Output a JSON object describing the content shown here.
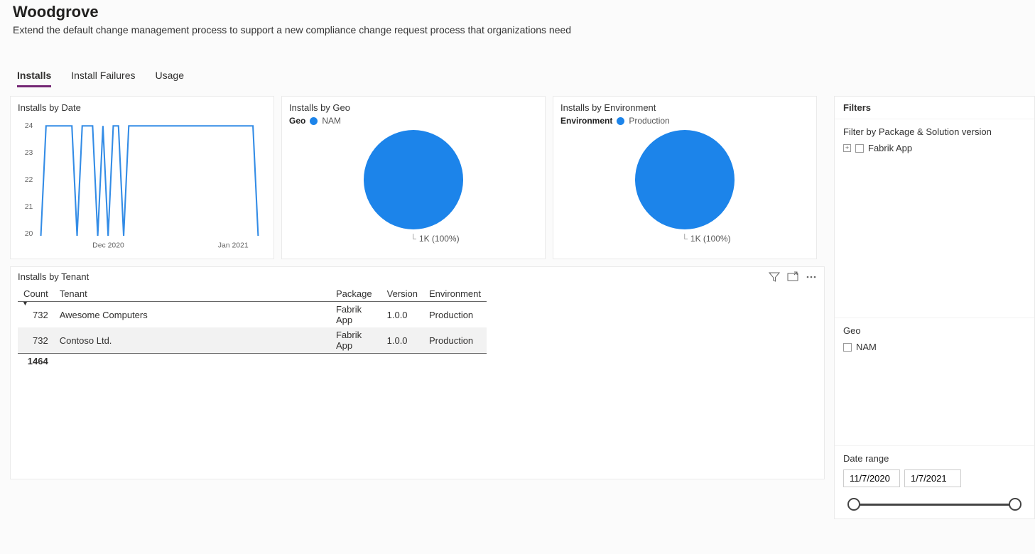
{
  "header": {
    "title": "Woodgrove",
    "subtitle": "Extend the default change management process to support a new compliance change request process that organizations need"
  },
  "tabs": [
    {
      "label": "Installs",
      "active": true
    },
    {
      "label": "Install Failures",
      "active": false
    },
    {
      "label": "Usage",
      "active": false
    }
  ],
  "cards": {
    "installs_by_date": {
      "title": "Installs by Date"
    },
    "installs_by_geo": {
      "title": "Installs by Geo",
      "legend_label": "Geo",
      "legend_value": "NAM",
      "caption": "1K (100%)",
      "color": "#1c84ea"
    },
    "installs_by_env": {
      "title": "Installs by Environment",
      "legend_label": "Environment",
      "legend_value": "Production",
      "caption": "1K (100%)",
      "color": "#1c84ea"
    }
  },
  "tenant_table": {
    "title": "Installs by Tenant",
    "headers": {
      "count": "Count",
      "tenant": "Tenant",
      "package": "Package",
      "version": "Version",
      "environment": "Environment"
    },
    "rows": [
      {
        "count": "732",
        "tenant": "Awesome Computers",
        "package": "Fabrik App",
        "version": "1.0.0",
        "environment": "Production"
      },
      {
        "count": "732",
        "tenant": "Contoso Ltd.",
        "package": "Fabrik App",
        "version": "1.0.0",
        "environment": "Production"
      }
    ],
    "total": "1464"
  },
  "filters": {
    "title": "Filters",
    "package_solution": {
      "title": "Filter by Package & Solution version",
      "item": "Fabrik App"
    },
    "geo": {
      "title": "Geo",
      "item": "NAM"
    },
    "date_range": {
      "title": "Date range",
      "from": "11/7/2020",
      "to": "1/7/2021"
    }
  },
  "chart_data": {
    "type": "line",
    "title": "Installs by Date",
    "xlabel": "",
    "ylabel": "",
    "ylim": [
      20,
      24
    ],
    "x_ticks": [
      "Dec 2020",
      "Jan 2021"
    ],
    "y_ticks": [
      20,
      21,
      22,
      23,
      24
    ],
    "series": [
      {
        "name": "Installs",
        "color": "#338ce6",
        "points": [
          {
            "x_index": 0,
            "y": 20
          },
          {
            "x_index": 1,
            "y": 24
          },
          {
            "x_index": 6,
            "y": 24
          },
          {
            "x_index": 7,
            "y": 20
          },
          {
            "x_index": 8,
            "y": 24
          },
          {
            "x_index": 10,
            "y": 24
          },
          {
            "x_index": 11,
            "y": 20
          },
          {
            "x_index": 12,
            "y": 24
          },
          {
            "x_index": 13,
            "y": 20
          },
          {
            "x_index": 14,
            "y": 24
          },
          {
            "x_index": 15,
            "y": 24
          },
          {
            "x_index": 16,
            "y": 20
          },
          {
            "x_index": 17,
            "y": 24
          },
          {
            "x_index": 41,
            "y": 24
          },
          {
            "x_index": 42,
            "y": 20
          }
        ],
        "x_domain": [
          0,
          42
        ]
      }
    ],
    "notes": "x_index represents approximate day offsets from start (11/7/2020); values read from y-axis gridlines."
  }
}
